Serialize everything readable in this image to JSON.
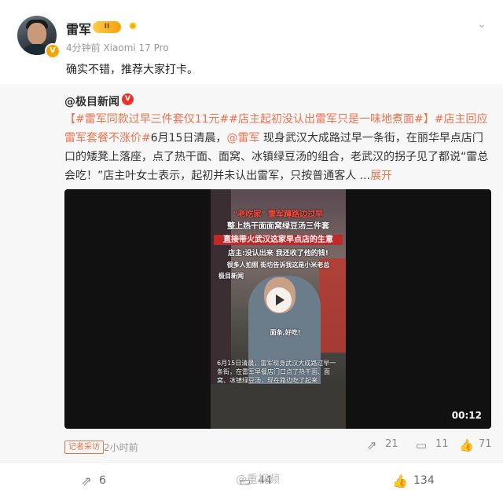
{
  "post": {
    "author": "雷军",
    "vip_level": "II",
    "meta": "4分钟前 Xiaomi 17 Pro",
    "text": "确实不错，推荐大家打卡。"
  },
  "original": {
    "author": "@极目新闻",
    "hashtag1": "#雷军同款过早三件套仅11元#",
    "hashtag2": "#店主起初没认出雷军只是一味地煮面#",
    "bracket_open": "【",
    "bracket_close": "】",
    "hashtag3": "#店主回应雷军套餐不涨价#",
    "text1": "6月15日清晨，",
    "mention": "@雷军",
    "text2": " 现身武汉大成路过早一条街，在丽华早点店门口的矮凳上落座，点了热干面、面窝、冰镇绿豆汤的组合，老武汉的拐子见了都说“雷总会吃！”店主叶女士表示，起初并未认出雷军，只按普通客人 ...",
    "expand": "展开",
    "video": {
      "caption_top1": "\"老吃家\" 雷军蹲路边过早",
      "caption_top2": "整上热干面面窝绿豆汤三件套",
      "caption_boxed": "直接带火武汉这家早点店的生意",
      "caption_quote": "店主:没认出来 我还收了他的钱!",
      "caption_many": "很多人拍照 街坊告诉我这是小米老总",
      "source_logo": "极目新闻",
      "small_text": "6月15日清晨，雷军现身武汉大成路过早一条街，在雷军早餐店门口点了热干面、面窝、冰镇绿豆汤，现在路边吃了起来",
      "speech": "面条,好吃!",
      "duration": "00:12"
    },
    "source_tag": "记者采访",
    "time": "2小时前",
    "reposts": "21",
    "comments": "11",
    "likes": "71"
  },
  "actions": {
    "reposts": "6",
    "comments": "44",
    "likes": "134",
    "watermark": "@重视频"
  },
  "icons": {
    "repost": "repost-icon",
    "comment": "comment-icon",
    "like": "like-icon",
    "more": "chevron-down-icon"
  }
}
